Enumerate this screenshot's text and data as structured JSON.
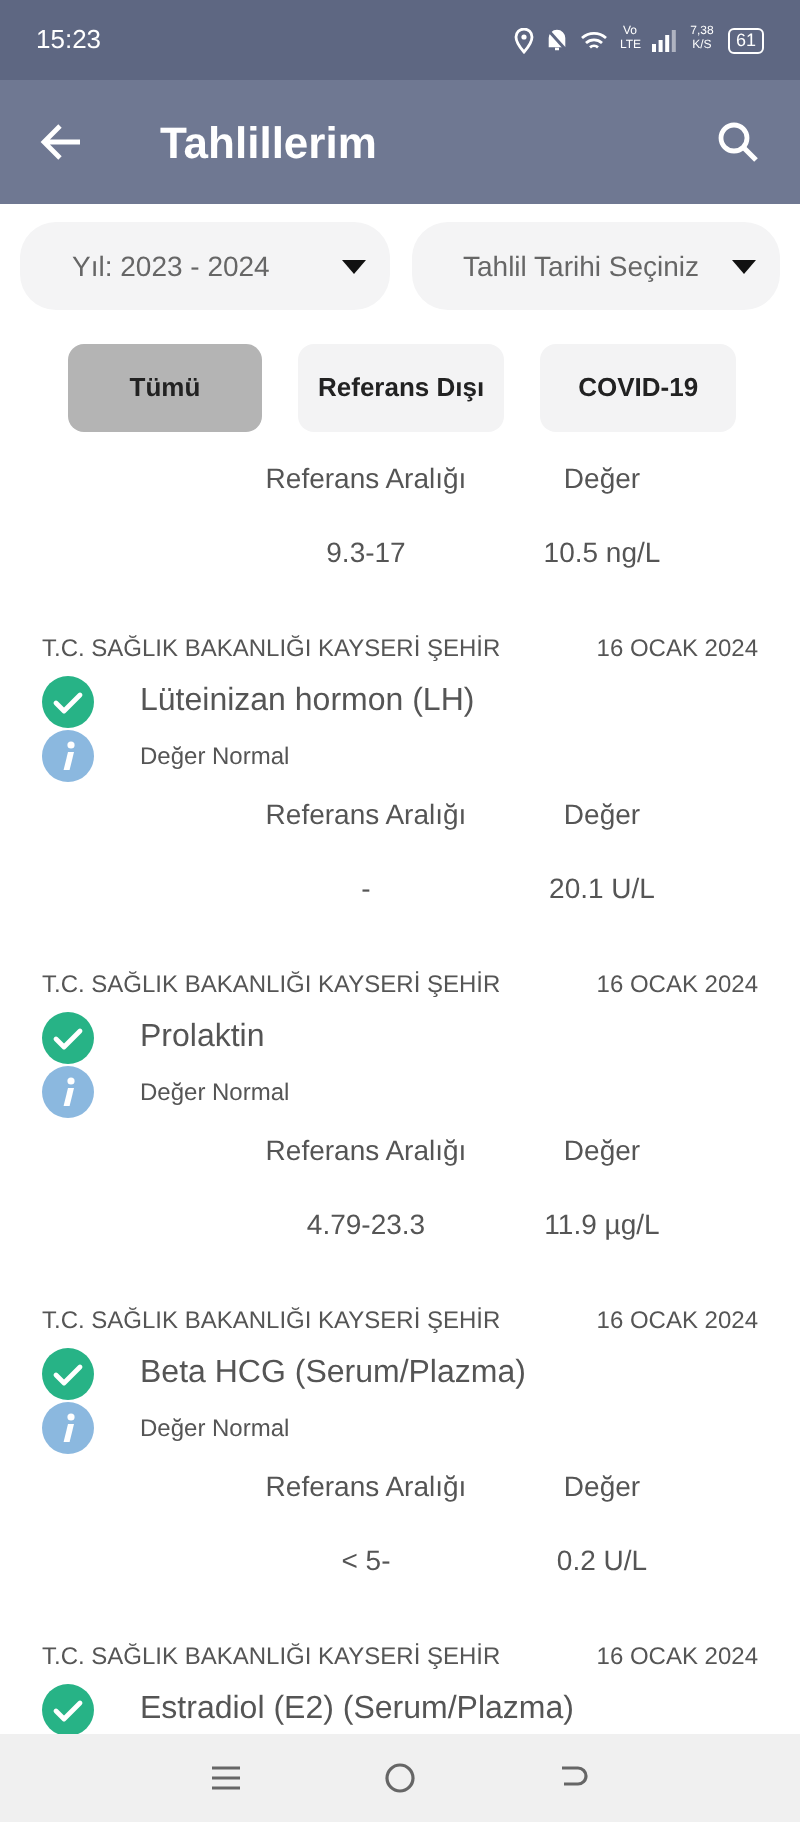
{
  "status_bar": {
    "time": "15:23",
    "network": "Vo LTE",
    "speed": "7,38 K/S",
    "battery": "61"
  },
  "app_bar": {
    "title": "Tahlillerim"
  },
  "filters": [
    {
      "label": "Yıl: 2023 - 2024"
    },
    {
      "label": "Tahlil Tarihi Seçiniz"
    }
  ],
  "chips": [
    {
      "label": "Tümü",
      "selected": true
    },
    {
      "label": "Referans Dışı",
      "selected": false
    },
    {
      "label": "COVID-19",
      "selected": false
    }
  ],
  "results": [
    {
      "range_label": "Referans Aralığı",
      "value_label": "Değer",
      "range": "9.3-17",
      "value": "10.5 ng/L"
    },
    {
      "hospital": "T.C. SAĞLIK BAKANLIĞI KAYSERİ ŞEHİR",
      "date": "16 OCAK 2024",
      "name": "Lüteinizan hormon (LH)",
      "status": "Değer Normal",
      "range_label": "Referans Aralığı",
      "value_label": "Değer",
      "range": "-",
      "value": "20.1 U/L"
    },
    {
      "hospital": "T.C. SAĞLIK BAKANLIĞI KAYSERİ ŞEHİR",
      "date": "16 OCAK 2024",
      "name": "Prolaktin",
      "status": "Değer Normal",
      "range_label": "Referans Aralığı",
      "value_label": "Değer",
      "range": "4.79-23.3",
      "value": "11.9 µg/L"
    },
    {
      "hospital": "T.C. SAĞLIK BAKANLIĞI KAYSERİ ŞEHİR",
      "date": "16 OCAK 2024",
      "name": "Beta HCG (Serum/Plazma)",
      "status": "Değer Normal",
      "range_label": "Referans Aralığı",
      "value_label": "Değer",
      "range": "< 5-",
      "value": "0.2 U/L"
    },
    {
      "hospital": "T.C. SAĞLIK BAKANLIĞI KAYSERİ ŞEHİR",
      "date": "16 OCAK 2024",
      "name": "Estradiol (E2) (Serum/Plazma)"
    }
  ]
}
